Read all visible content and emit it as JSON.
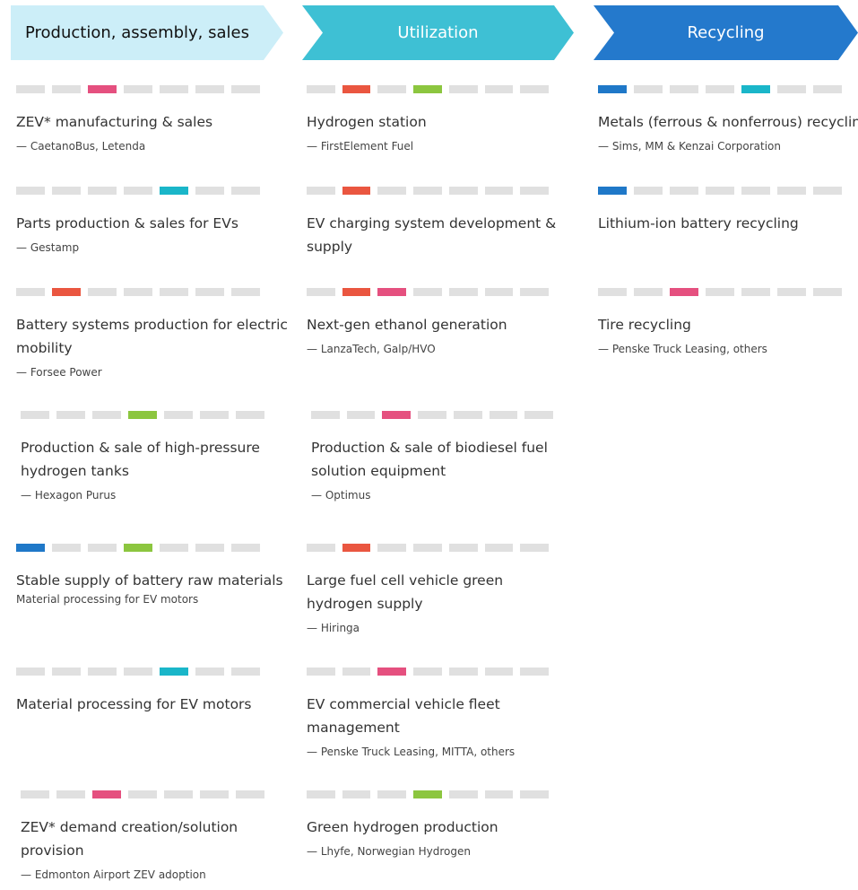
{
  "colors": {
    "gray": "#e0e0e0",
    "blue": "#1f78c8",
    "cyan": "#1ab6c9",
    "red": "#ea5640",
    "pink": "#e5507f",
    "green": "#8cc63f",
    "header_light": "#cceef8",
    "header_mid": "#3ec0d4",
    "header_dark": "#2479cc"
  },
  "headers": [
    "Production, assembly, sales",
    "Utilization",
    "Recycling"
  ],
  "columns": [
    {
      "items": [
        {
          "bars": [
            "gray",
            "gray",
            "pink",
            "gray",
            "gray",
            "gray",
            "gray"
          ],
          "title_lines": [
            "ZEV* manufacturing & sales"
          ],
          "sub": "— CaetanoBus, Letenda"
        },
        {
          "bars": [
            "gray",
            "gray",
            "gray",
            "gray",
            "cyan",
            "gray",
            "gray"
          ],
          "title_lines": [
            "Parts production & sales for EVs"
          ],
          "sub": "— Gestamp"
        },
        {
          "bars": [
            "gray",
            "red",
            "gray",
            "gray",
            "gray",
            "gray",
            "gray"
          ],
          "title_lines": [
            "Battery systems production for electric",
            "mobility"
          ],
          "sub": "— Forsee Power"
        },
        {
          "bars": [
            "gray",
            "gray",
            "gray",
            "green",
            "gray",
            "gray",
            "gray"
          ],
          "title_lines": [
            "Production & sale of high-pressure",
            "hydrogen tanks"
          ],
          "sub": "— Hexagon Purus"
        },
        {
          "bars": [
            "blue",
            "gray",
            "gray",
            "green",
            "gray",
            "gray",
            "gray"
          ],
          "title_lines": [
            "Stable supply of battery raw materials"
          ],
          "sub": "Material processing for EV motors"
        },
        {
          "bars": [
            "gray",
            "gray",
            "gray",
            "gray",
            "cyan",
            "gray",
            "gray"
          ],
          "title_lines": [
            "Material processing for EV motors"
          ],
          "sub": ""
        },
        {
          "bars": [
            "gray",
            "gray",
            "pink",
            "gray",
            "gray",
            "gray",
            "gray"
          ],
          "title_lines": [
            "ZEV* demand creation/solution",
            "provision"
          ],
          "sub": "— Edmonton Airport ZEV adoption"
        }
      ]
    },
    {
      "items": [
        {
          "bars": [
            "gray",
            "red",
            "gray",
            "green",
            "gray",
            "gray",
            "gray"
          ],
          "title_lines": [
            "Hydrogen station"
          ],
          "sub": "— FirstElement Fuel"
        },
        {
          "bars": [
            "gray",
            "red",
            "gray",
            "gray",
            "gray",
            "gray",
            "gray"
          ],
          "title_lines": [
            "EV charging system development &",
            "supply"
          ],
          "sub": ""
        },
        {
          "bars": [
            "gray",
            "red",
            "pink",
            "gray",
            "gray",
            "gray",
            "gray"
          ],
          "title_lines": [
            "Next-gen ethanol generation"
          ],
          "sub": "— LanzaTech, Galp/HVO"
        },
        {
          "bars": [
            "gray",
            "gray",
            "pink",
            "gray",
            "gray",
            "gray",
            "gray"
          ],
          "title_lines": [
            "Production & sale of biodiesel fuel",
            "solution equipment"
          ],
          "sub": "— Optimus"
        },
        {
          "bars": [
            "gray",
            "red",
            "gray",
            "gray",
            "gray",
            "gray",
            "gray"
          ],
          "title_lines": [
            "Large fuel cell vehicle green",
            "hydrogen supply"
          ],
          "sub": "— Hiringa"
        },
        {
          "bars": [
            "gray",
            "gray",
            "pink",
            "gray",
            "gray",
            "gray",
            "gray"
          ],
          "title_lines": [
            "EV commercial vehicle fleet",
            "management"
          ],
          "sub": "— Penske Truck Leasing, MITTA, others"
        },
        {
          "bars": [
            "gray",
            "gray",
            "gray",
            "green",
            "gray",
            "gray",
            "gray"
          ],
          "title_lines": [
            "Green hydrogen production"
          ],
          "sub": "— Lhyfe, Norwegian Hydrogen"
        }
      ]
    },
    {
      "items": [
        {
          "bars": [
            "blue",
            "gray",
            "gray",
            "gray",
            "cyan",
            "gray",
            "gray"
          ],
          "title_lines": [
            "Metals (ferrous & nonferrous) recycling"
          ],
          "sub": "— Sims, MM & Kenzai Corporation"
        },
        {
          "bars": [
            "blue",
            "gray",
            "gray",
            "gray",
            "gray",
            "gray",
            "gray"
          ],
          "title_lines": [
            "Lithium-ion battery recycling"
          ],
          "sub": ""
        },
        {
          "bars": [
            "gray",
            "gray",
            "pink",
            "gray",
            "gray",
            "gray",
            "gray"
          ],
          "title_lines": [
            "Tire recycling"
          ],
          "sub": "— Penske Truck Leasing, others"
        }
      ]
    }
  ]
}
